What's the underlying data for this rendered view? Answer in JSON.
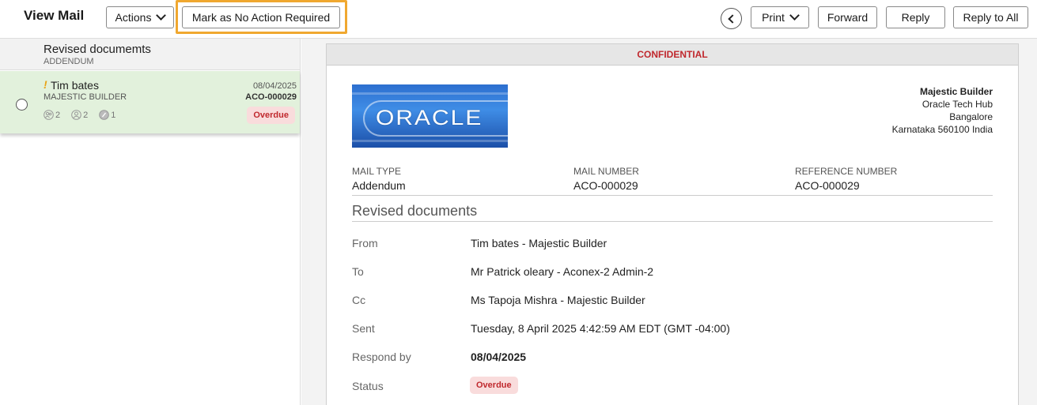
{
  "header": {
    "title": "View Mail",
    "actions_label": "Actions",
    "mark_label": "Mark as No Action Required",
    "print_label": "Print",
    "forward_label": "Forward",
    "reply_label": "Reply",
    "reply_all_label": "Reply to All"
  },
  "thread": {
    "title": "Revised documemts",
    "subtitle": "ADDENDUM",
    "item": {
      "priority_mark": "!",
      "sender": "Tim bates",
      "org": "MAJESTIC BUILDER",
      "date": "08/04/2025",
      "number": "ACO-000029",
      "to_count": "2",
      "cc_count": "2",
      "attach_count": "1",
      "status": "Overdue"
    }
  },
  "mail": {
    "confidential": "CONFIDENTIAL",
    "logo_text": "ORACLE",
    "address": {
      "company": "Majestic Builder",
      "line1": "Oracle Tech Hub",
      "line2": "Bangalore",
      "line3": "Karnataka 560100 India"
    },
    "mail_type_label": "MAIL TYPE",
    "mail_type": "Addendum",
    "mail_number_label": "MAIL NUMBER",
    "mail_number": "ACO-000029",
    "reference_label": "REFERENCE NUMBER",
    "reference": "ACO-000029",
    "subject": "Revised documents",
    "from_label": "From",
    "from": "Tim bates - Majestic Builder",
    "to_label": "To",
    "to": "Mr Patrick oleary - Aconex-2 Admin-2",
    "cc_label": "Cc",
    "cc": "Ms Tapoja Mishra - Majestic Builder",
    "sent_label": "Sent",
    "sent": "Tuesday, 8 April 2025 4:42:59 AM EDT (GMT -04:00)",
    "respond_label": "Respond by",
    "respond": "08/04/2025",
    "status_label": "Status",
    "status": "Overdue"
  },
  "colors": {
    "accent_highlight": "#f0a830",
    "selected_row": "#e2f1dc",
    "overdue_bg": "#f9dcdc",
    "overdue_text": "#c0282d",
    "priority": "#e8a317"
  }
}
